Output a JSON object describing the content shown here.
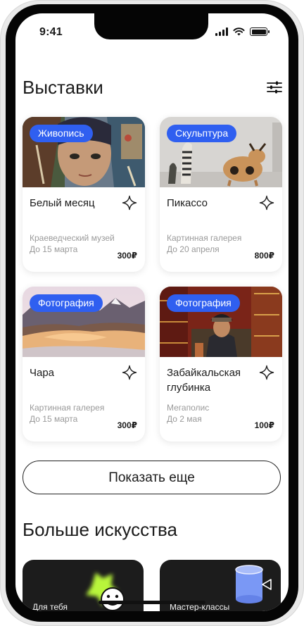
{
  "status_bar": {
    "time": "9:41"
  },
  "exhibitions": {
    "title": "Выставки",
    "cards": [
      {
        "tag": "Живопись",
        "title": "Белый месяц",
        "venue": "Краеведческий музей",
        "date": "До 15 марта",
        "price": "300₽"
      },
      {
        "tag": "Скульптура",
        "title": "Пикассо",
        "venue": "Картинная галерея",
        "date": "До 20 апреля",
        "price": "800₽"
      },
      {
        "tag": "Фотография",
        "title": "Чара",
        "venue": "Картинная галерея",
        "date": "До 15 марта",
        "price": "300₽"
      },
      {
        "tag": "Фотография",
        "title": "Забайкальская глубинка",
        "venue": "Мегаполис",
        "date": "До 2 мая",
        "price": "100₽"
      }
    ],
    "show_more_label": "Показать еще"
  },
  "more_art": {
    "title": "Больше искусства",
    "cards": [
      {
        "label": "Для тебя"
      },
      {
        "label": "Мастер-классы"
      }
    ]
  },
  "icons": {
    "filter": "sliders-icon",
    "favorite": "star-outline-icon"
  },
  "colors": {
    "accent": "#2f5ff0",
    "card_dark": "#1c1c1c"
  }
}
